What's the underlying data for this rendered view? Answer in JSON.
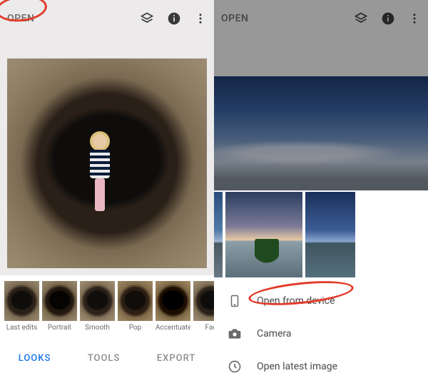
{
  "left": {
    "topbar": {
      "open_label": "OPEN"
    },
    "filmstrip": [
      {
        "label": "Last edits"
      },
      {
        "label": "Portrait"
      },
      {
        "label": "Smooth"
      },
      {
        "label": "Pop"
      },
      {
        "label": "Accentuate"
      },
      {
        "label": "Fac"
      }
    ],
    "tabs": {
      "looks": "LOOKS",
      "tools": "TOOLS",
      "export": "EXPORT",
      "active": "looks"
    }
  },
  "right": {
    "topbar": {
      "open_label": "OPEN"
    },
    "sheet": {
      "options": {
        "open_from_device": "Open from device",
        "camera": "Camera",
        "open_latest": "Open latest image"
      }
    }
  },
  "annotations": {
    "left_circle_target": "open-button",
    "right_circle_target": "open-from-device-row"
  }
}
